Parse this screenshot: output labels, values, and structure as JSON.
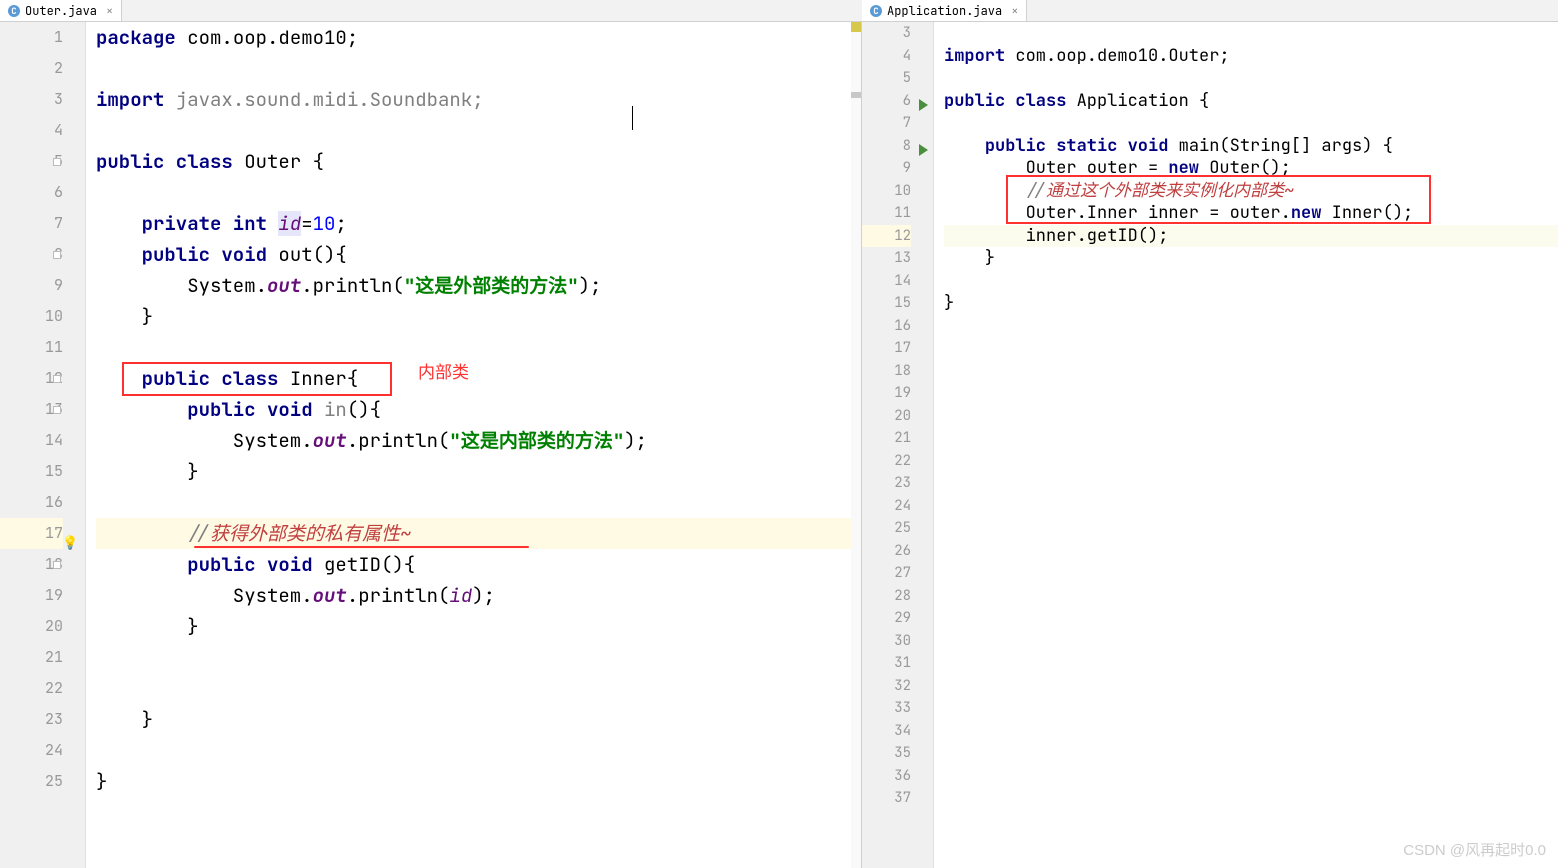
{
  "tabs": {
    "left": {
      "icon": "C",
      "label": "Outer.java"
    },
    "right": {
      "icon": "C",
      "label": "Application.java"
    }
  },
  "annotations": {
    "inner_class_label": "内部类"
  },
  "left_code": {
    "lines": [
      {
        "n": 1,
        "html": "<span class='kw'>package</span> com.oop.demo10;"
      },
      {
        "n": 2,
        "html": ""
      },
      {
        "n": 3,
        "html": "<span class='kw'>import</span> <span class='grey-import'>javax.sound.midi.Soundbank;</span>"
      },
      {
        "n": 4,
        "html": ""
      },
      {
        "n": 5,
        "html": "<span class='kw'>public class</span> Outer {"
      },
      {
        "n": 6,
        "html": ""
      },
      {
        "n": 7,
        "html": "    <span class='kw'>private int</span> <span class='hl-id fld'>id</span>=<span class='num'>10</span>;"
      },
      {
        "n": 8,
        "html": "    <span class='kw'>public void</span> out(){"
      },
      {
        "n": 9,
        "html": "        System.<span class='fld-bold'>out</span>.println(<span class='str'>\"这是外部类的方法\"</span>);"
      },
      {
        "n": 10,
        "html": "    }"
      },
      {
        "n": 11,
        "html": ""
      },
      {
        "n": 12,
        "html": "    <span class='kw'>public class</span> Inner{"
      },
      {
        "n": 13,
        "html": "        <span class='kw'>public void</span> <span class='grey-import'>in</span>(){"
      },
      {
        "n": 14,
        "html": "            System.<span class='fld-bold'>out</span>.println(<span class='str'>\"这是内部类的方法\"</span>);"
      },
      {
        "n": 15,
        "html": "        }"
      },
      {
        "n": 16,
        "html": ""
      },
      {
        "n": 17,
        "html": "        <span class='cmt'>//</span><span class='cmt-red'>获得外部类的私有属性~</span>"
      },
      {
        "n": 18,
        "html": "        <span class='kw'>public void</span> getID(){"
      },
      {
        "n": 19,
        "html": "            System.<span class='fld-bold'>out</span>.println(<span class='fld'>id</span>);"
      },
      {
        "n": 20,
        "html": "        }"
      },
      {
        "n": 21,
        "html": ""
      },
      {
        "n": 22,
        "html": ""
      },
      {
        "n": 23,
        "html": "    }"
      },
      {
        "n": 24,
        "html": ""
      },
      {
        "n": 25,
        "html": "}"
      }
    ]
  },
  "right_code": {
    "lines": [
      {
        "n": 3,
        "html": ""
      },
      {
        "n": 4,
        "html": "<span class='kw'>import</span> com.oop.demo10.Outer;"
      },
      {
        "n": 5,
        "html": ""
      },
      {
        "n": 6,
        "html": "<span class='kw'>public class</span> Application {",
        "run": true
      },
      {
        "n": 7,
        "html": ""
      },
      {
        "n": 8,
        "html": "    <span class='kw'>public static void</span> main(String[] args) {",
        "run": true
      },
      {
        "n": 9,
        "html": "        Outer outer = <span class='kw'>new</span> Outer();"
      },
      {
        "n": 10,
        "html": "        <span class='cmt'>//</span><span class='cmt-red'>通过这个外部类来实例化内部类~</span>"
      },
      {
        "n": 11,
        "html": "        Outer.Inner inner = outer.<span class='kw'>new</span> Inner();"
      },
      {
        "n": 12,
        "html": "        inner.getID();"
      },
      {
        "n": 13,
        "html": "    }"
      },
      {
        "n": 14,
        "html": ""
      },
      {
        "n": 15,
        "html": "}"
      },
      {
        "n": 16,
        "html": ""
      },
      {
        "n": 17,
        "html": ""
      },
      {
        "n": 18,
        "html": ""
      },
      {
        "n": 19,
        "html": ""
      },
      {
        "n": 20,
        "html": ""
      },
      {
        "n": 21,
        "html": ""
      },
      {
        "n": 22,
        "html": ""
      },
      {
        "n": 23,
        "html": ""
      },
      {
        "n": 24,
        "html": ""
      },
      {
        "n": 25,
        "html": ""
      },
      {
        "n": 26,
        "html": ""
      },
      {
        "n": 27,
        "html": ""
      },
      {
        "n": 28,
        "html": ""
      },
      {
        "n": 29,
        "html": ""
      },
      {
        "n": 30,
        "html": ""
      },
      {
        "n": 31,
        "html": ""
      },
      {
        "n": 32,
        "html": ""
      },
      {
        "n": 33,
        "html": ""
      },
      {
        "n": 34,
        "html": ""
      },
      {
        "n": 35,
        "html": ""
      },
      {
        "n": 36,
        "html": ""
      },
      {
        "n": 37,
        "html": ""
      }
    ]
  },
  "watermark": "CSDN @风再起时0.0"
}
